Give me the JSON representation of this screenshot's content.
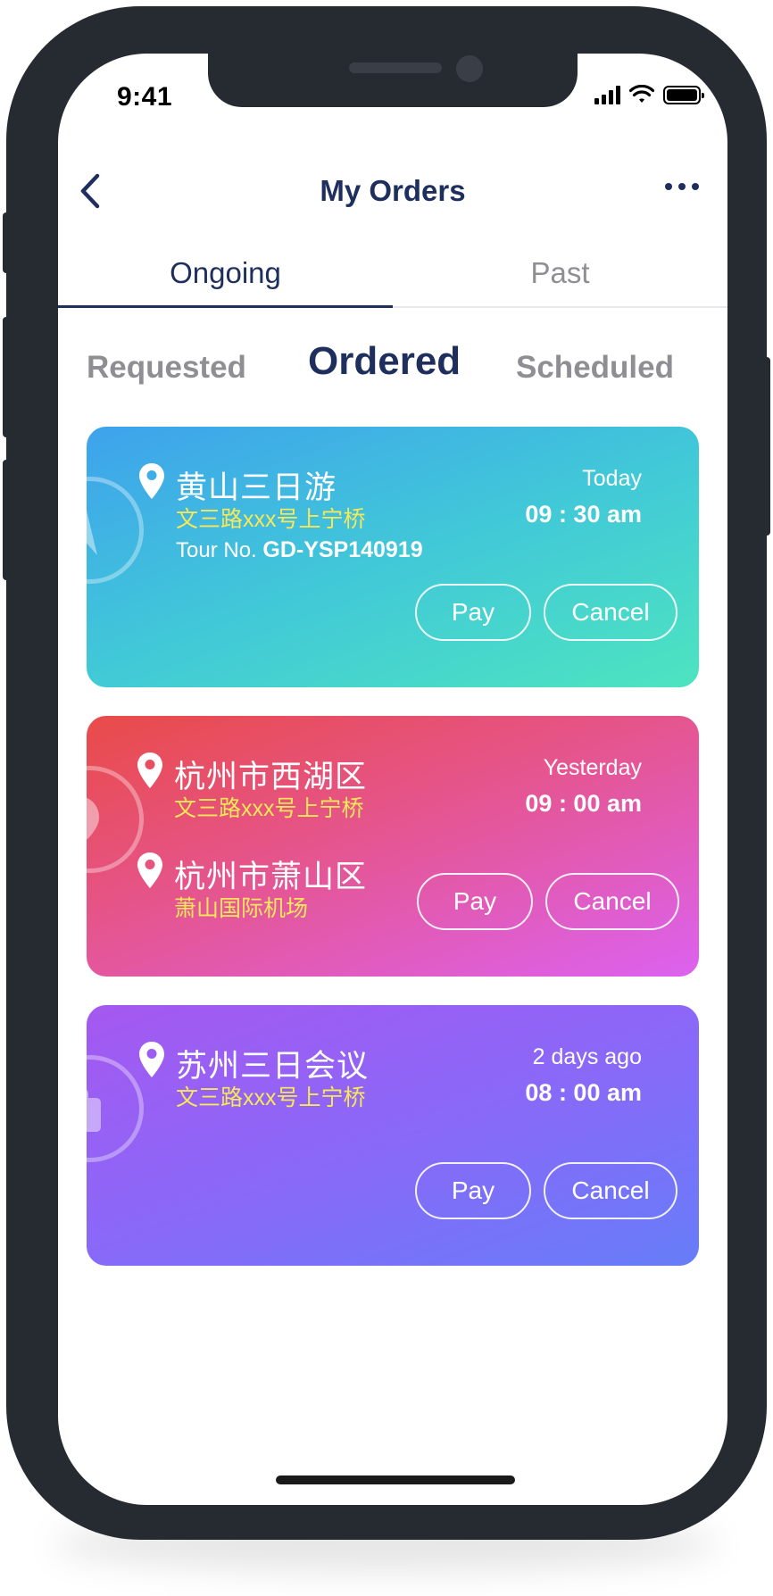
{
  "status_bar": {
    "time": "9:41"
  },
  "nav": {
    "title": "My Orders"
  },
  "tabs": [
    {
      "label": "Ongoing",
      "active": true
    },
    {
      "label": "Past",
      "active": false
    }
  ],
  "subtabs": [
    {
      "label": "Requested",
      "active": false
    },
    {
      "label": "Ordered",
      "active": true
    },
    {
      "label": "Scheduled",
      "active": false
    }
  ],
  "orders": [
    {
      "place": "黄山三日游",
      "address": "文三路xxx号上宁桥",
      "tour_label": "Tour No.",
      "tour_no": "GD-YSP140919",
      "when": "Today",
      "time": "09 : 30 am",
      "pay_label": "Pay",
      "cancel_label": "Cancel",
      "deco_icon": "compass-icon"
    },
    {
      "place": "杭州市西湖区",
      "address": "文三路xxx号上宁桥",
      "destination": "杭州市萧山区",
      "destination_address": "萧山国际机场",
      "when": "Yesterday",
      "time": "09 : 00 am",
      "pay_label": "Pay",
      "cancel_label": "Cancel",
      "deco_icon": "location-pin-icon"
    },
    {
      "place": "苏州三日会议",
      "address": "文三路xxx号上宁桥",
      "when": "2 days ago",
      "time": "08 : 00 am",
      "pay_label": "Pay",
      "cancel_label": "Cancel",
      "deco_icon": "briefcase-icon"
    }
  ],
  "colors": {
    "nav_text": "#1e2f5e",
    "inactive_text": "#8e8e93",
    "address_yellow": "#f7e857",
    "card1_gradient": [
      "#3ea2ec",
      "#4de4c0"
    ],
    "card2_gradient": [
      "#e94b48",
      "#dc62f0"
    ],
    "card3_gradient": [
      "#a558f0",
      "#667df8"
    ]
  }
}
